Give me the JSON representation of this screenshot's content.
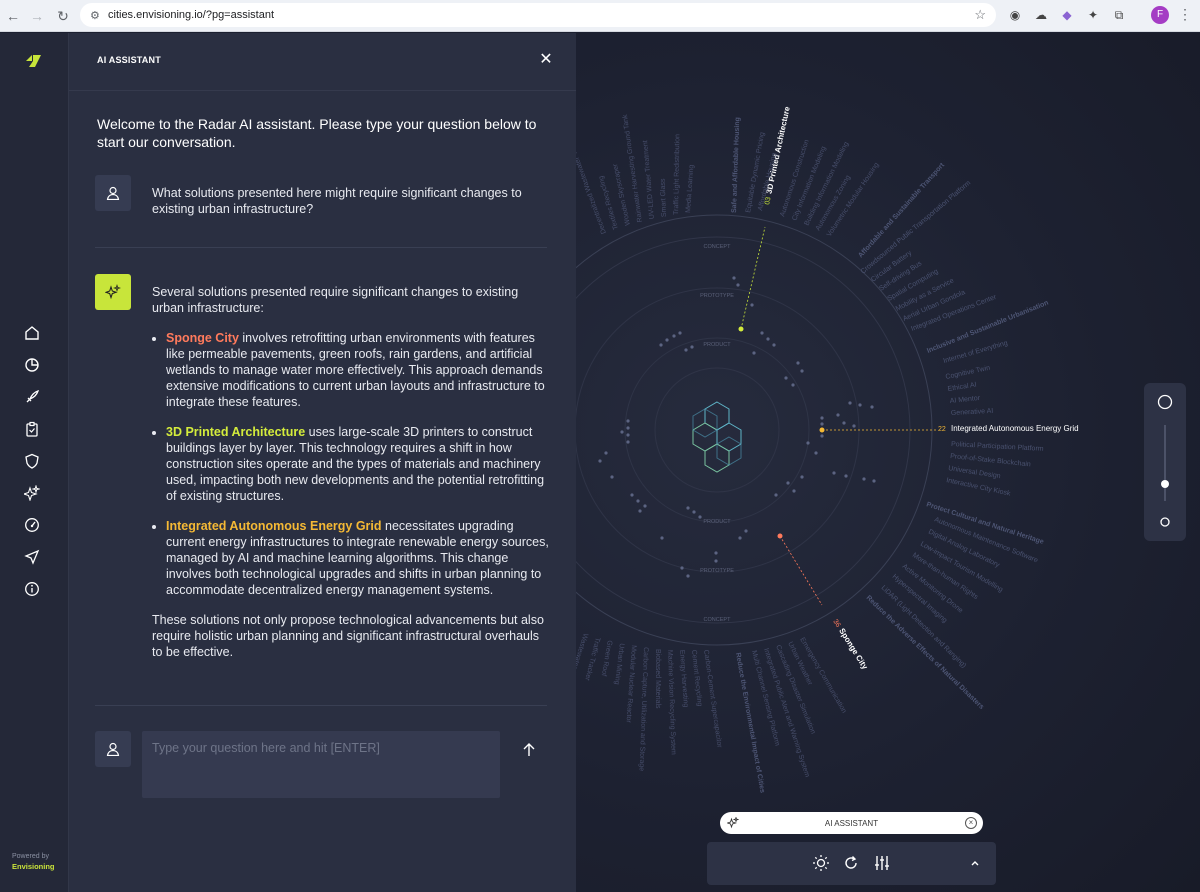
{
  "browser": {
    "url": "cities.envisioning.io/?pg=assistant",
    "profile_initial": "F"
  },
  "rail": {
    "powered_by": "Powered by",
    "brand": "Envisioning",
    "icons": [
      "home-icon",
      "chart-pie-icon",
      "rocket-icon",
      "clipboard-icon",
      "shield-icon",
      "sparkles-icon",
      "gauge-icon",
      "send-icon",
      "info-icon"
    ]
  },
  "assistant": {
    "title": "AI ASSISTANT",
    "welcome": "Welcome to the Radar AI assistant. Please type your question below to start our conversation.",
    "question": "What solutions presented here might require significant changes to existing urban infrastructure?",
    "answer_intro": "Several solutions presented require significant changes to existing urban infrastructure:",
    "items": [
      {
        "name": "Sponge City",
        "text": " involves retrofitting urban environments with features like permeable pavements, green roofs, rain gardens, and artificial wetlands to manage water more effectively. This approach demands extensive modifications to current urban layouts and infrastructure to integrate these features."
      },
      {
        "name": "3D Printed Architecture",
        "text": " uses large-scale 3D printers to construct buildings layer by layer. This technology requires a shift in how construction sites operate and the types of materials and machinery used, impacting both new developments and the potential retrofitting of existing structures."
      },
      {
        "name": "Integrated Autonomous Energy Grid",
        "text": " necessitates upgrading current energy infrastructures to integrate renewable energy sources, managed by AI and machine learning algorithms. This change involves both technological upgrades and shifts in urban planning to accommodate decentralized energy management systems."
      }
    ],
    "answer_outro": "These solutions not only propose technological advancements but also require holistic urban planning and significant infrastructural overhauls to be effective.",
    "input_placeholder": "Type your question here and hit [ENTER]"
  },
  "radar": {
    "ring_labels": [
      "CONCEPT",
      "PROTOTYPE",
      "PRODUCT"
    ],
    "highlight_top": {
      "num": "03",
      "label": "3D Printed Architecture"
    },
    "highlight_right": {
      "num": "22",
      "label": "Integrated Autonomous Energy Grid"
    },
    "highlight_bottom": {
      "num": "36",
      "label": "Sponge City"
    },
    "categories": [
      "Affordable and Sustainable Transport",
      "Inclusive and Sustainable Urbanisation",
      "Protect Cultural and Natural Heritage",
      "Reduce the Adverse Effects of Natural Disasters",
      "Reduce the Environmental Impact of Cities",
      "Safe and Affordable Housing"
    ],
    "right_list": [
      {
        "num": "17",
        "label": "Internet of Everything"
      },
      {
        "num": "18",
        "label": "Cognitive Twin"
      },
      {
        "num": "19",
        "label": "Ethical AI"
      },
      {
        "num": "20",
        "label": "AI Mentor"
      },
      {
        "num": "21",
        "label": "Generative AI"
      },
      {
        "num": "23",
        "label": "Political Participation Platform"
      },
      {
        "num": "24",
        "label": "Proof-of-Stake Blockchain"
      },
      {
        "num": "25",
        "label": "Universal Design"
      },
      {
        "num": "26",
        "label": "Interactive City Kiosk"
      }
    ],
    "upper_right_list": [
      {
        "num": "09",
        "label": "Crowdsourced Public Transportation Platform"
      },
      {
        "num": "10",
        "label": "Circular Battery"
      },
      {
        "num": "11",
        "label": "Self-driving Bus"
      },
      {
        "num": "12",
        "label": "Spatial Computing"
      },
      {
        "num": "13",
        "label": "Mobility as a Service"
      },
      {
        "num": "14",
        "label": "Aerial Urban Gondola"
      },
      {
        "num": "15",
        "label": "Integrated Operations Center"
      }
    ],
    "lower_right_list": [
      {
        "num": "27",
        "label": "Autonomous Maintenance Software"
      },
      {
        "num": "28",
        "label": "Digital Analog Laboratory"
      },
      {
        "num": "29",
        "label": "Low-impact Tourism Modelling"
      },
      {
        "num": "30",
        "label": "More-than-human Rights"
      },
      {
        "num": "31",
        "label": "Active Monitoring Drone"
      },
      {
        "num": "32",
        "label": "Hyperspectral Imaging"
      },
      {
        "num": "33",
        "label": "LiDAR (Light Detection and Ranging)"
      }
    ],
    "top_list": [
      "Decentralized Wastewater Treatment",
      "Textiles Recycling",
      "Wooden Skyscraper",
      "Rainwater Harvesting Ground Tank",
      "UV-LED Water Treatment",
      "Smart Glass",
      "Traffic Light Redistribution",
      "Media Learning",
      "Equitable Dynamic Pricing",
      "Affordable Housing",
      "Autonomous Construction",
      "City Information Modeling",
      "Building Information Modeling",
      "Autonomous Zoning",
      "Volumetric Modular Housing"
    ],
    "bottom_list": [
      "Wastewater Analysis Platform",
      "Traffic Tracker",
      "Green Roof",
      "Urban Mining",
      "Modular Nuclear Reactor",
      "Carbon Capture, Utilization and Storage",
      "Biobased Materials",
      "Machine Vision Recycling System",
      "Energy Harvesting",
      "Cement Recycling",
      "Carbon-Cement Supercapacitor",
      "Multi Channel Sensing Platform",
      "Integrated Public Alert and Warning System",
      "Cascading Disaster Simulation",
      "Urban Weather",
      "Emergency Communication"
    ]
  },
  "bottom": {
    "pill_label": "AI ASSISTANT"
  }
}
